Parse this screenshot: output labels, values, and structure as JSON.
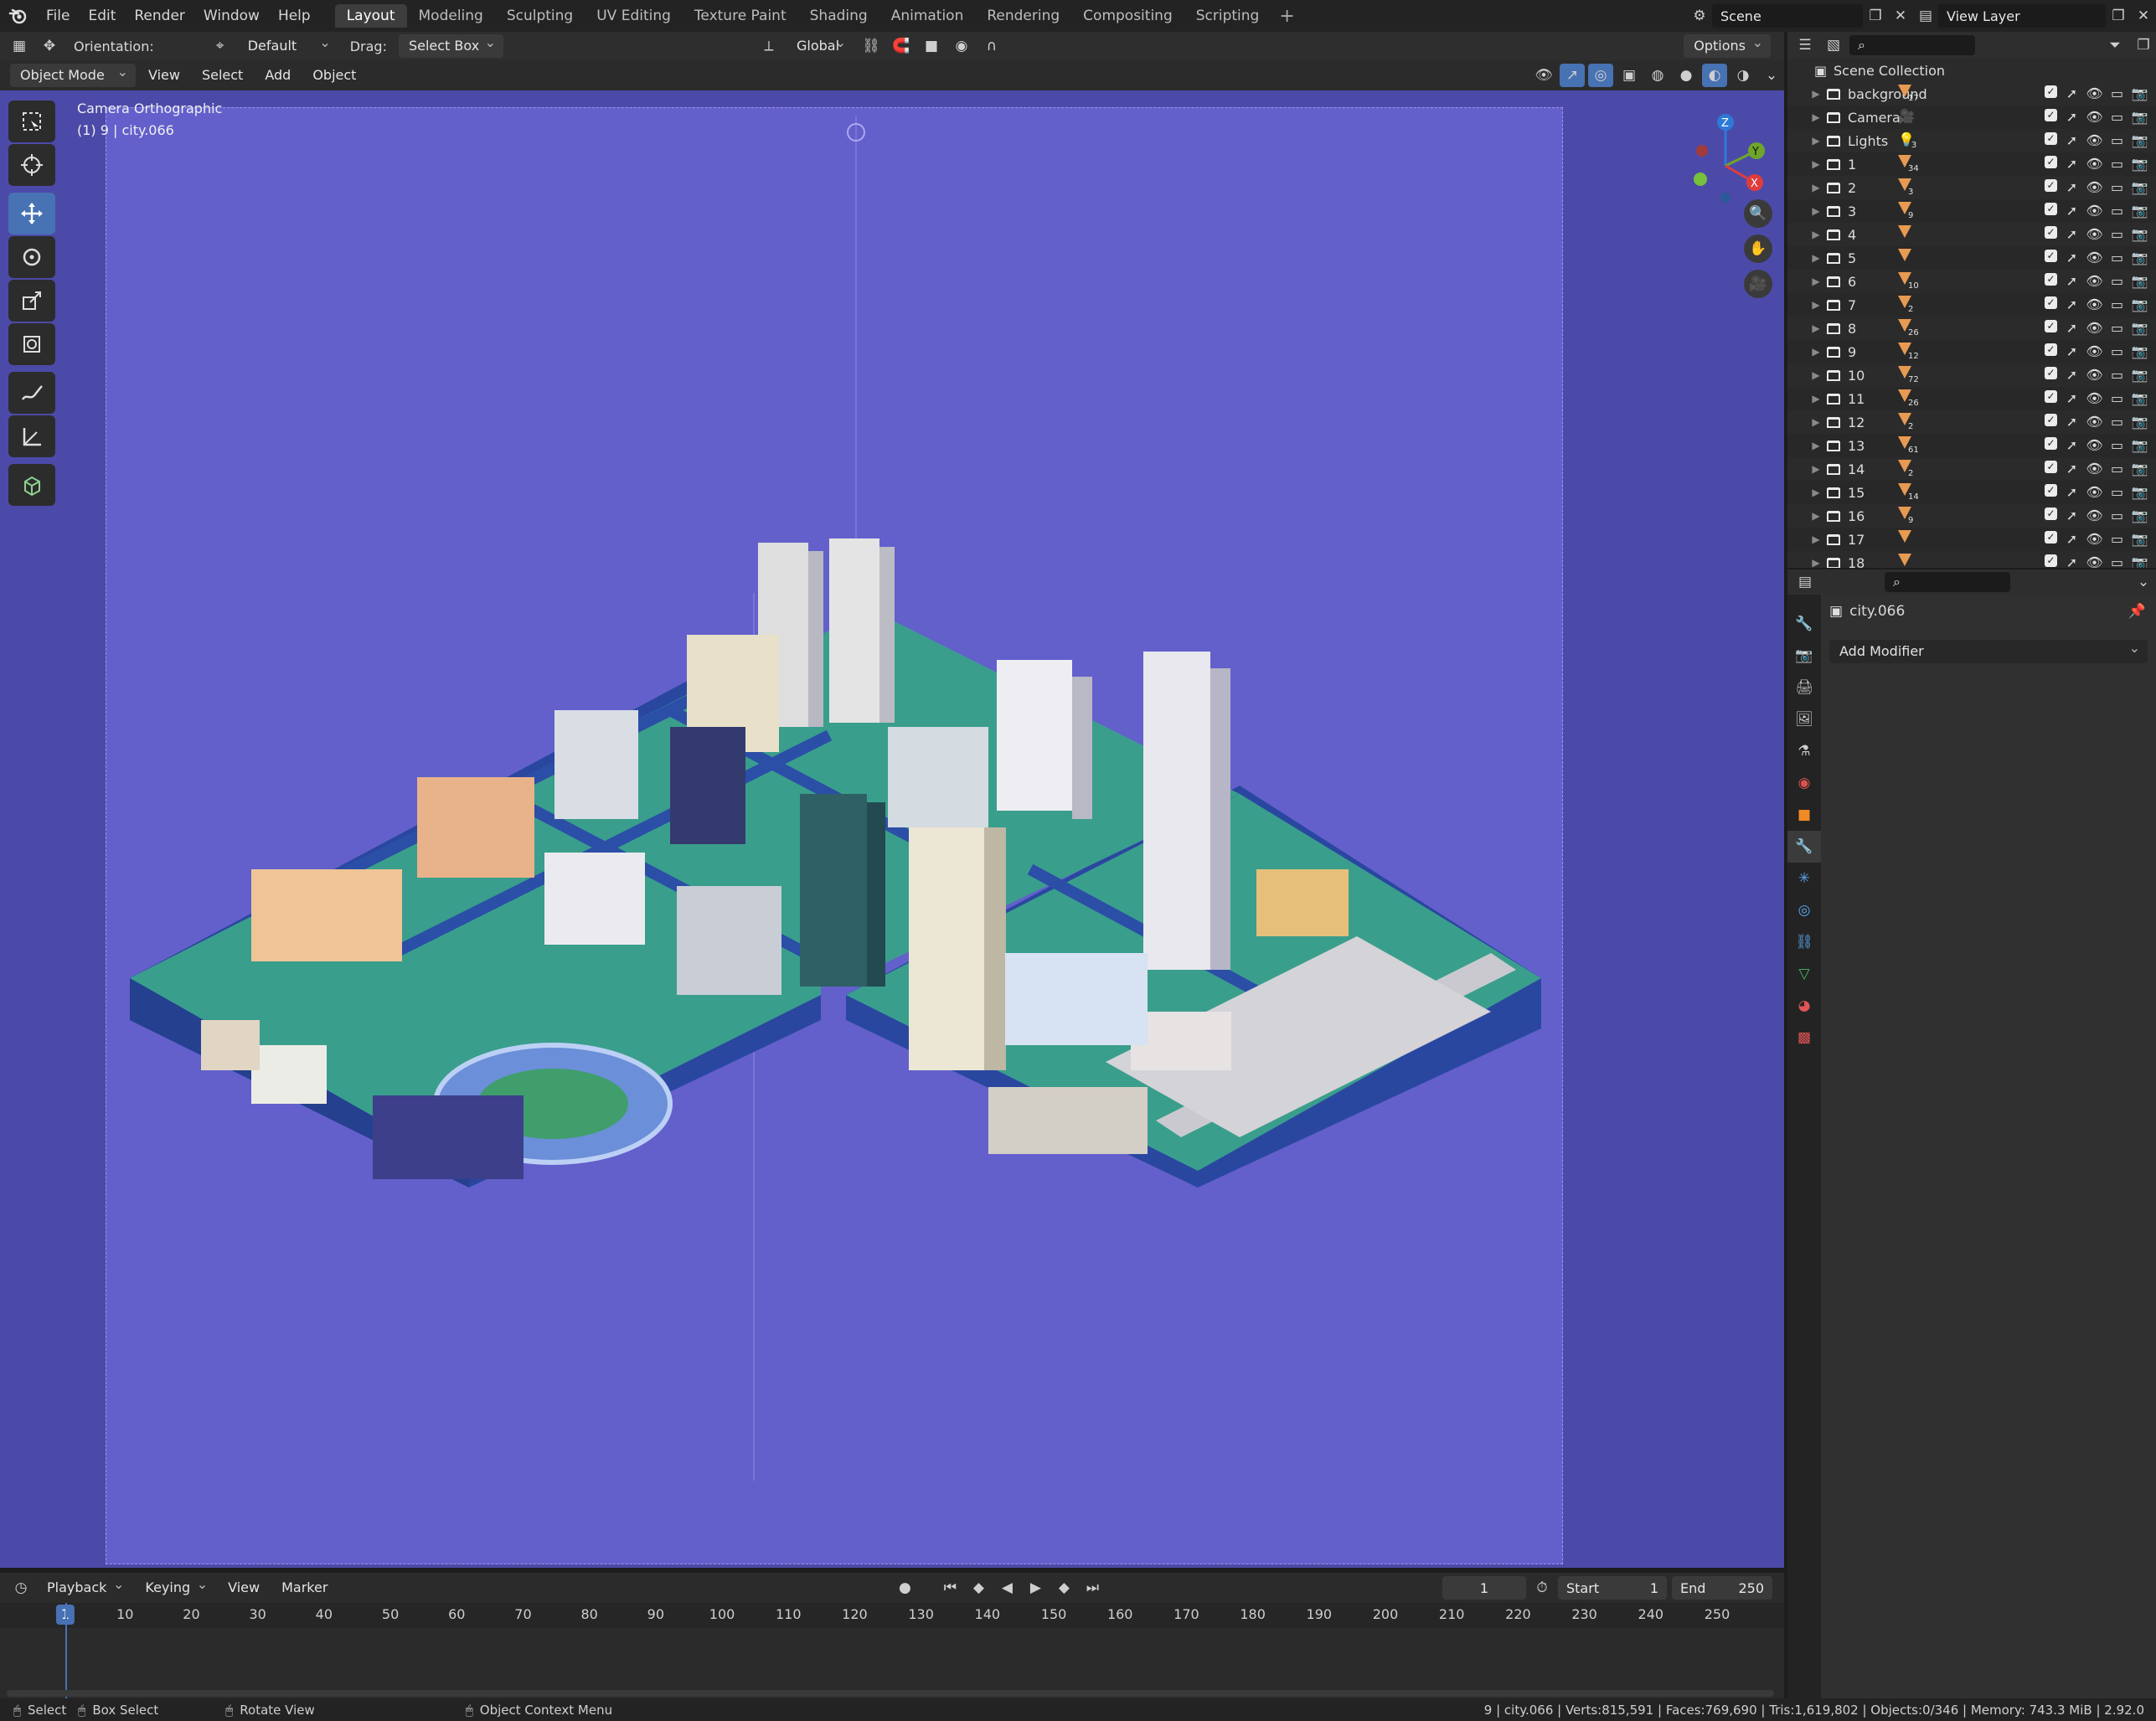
{
  "menubar": {
    "items": [
      "File",
      "Edit",
      "Render",
      "Window",
      "Help"
    ],
    "workspaces": [
      "Layout",
      "Modeling",
      "Sculpting",
      "UV Editing",
      "Texture Paint",
      "Shading",
      "Animation",
      "Rendering",
      "Compositing",
      "Scripting"
    ],
    "active_workspace": "Layout",
    "scene": "Scene",
    "view_layer": "View Layer"
  },
  "tool_header": {
    "orientation_label": "Orientation:",
    "orientation_value": "Default",
    "drag_label": "Drag:",
    "drag_value": "Select Box",
    "transform_orientation": "Global",
    "options_label": "Options"
  },
  "viewport_header": {
    "mode": "Object Mode",
    "menus": [
      "View",
      "Select",
      "Add",
      "Object"
    ]
  },
  "viewport": {
    "camera_label": "Camera Orthographic",
    "object_label": "(1) 9 | city.066"
  },
  "outliner": {
    "root": "Scene Collection",
    "rows": [
      {
        "name": "background",
        "count": "17",
        "kind": "mesh"
      },
      {
        "name": "Camera",
        "count": "",
        "kind": "camera"
      },
      {
        "name": "Lights",
        "count": "3",
        "kind": "light"
      },
      {
        "name": "1",
        "count": "34",
        "kind": "mesh"
      },
      {
        "name": "2",
        "count": "3",
        "kind": "mesh"
      },
      {
        "name": "3",
        "count": "9",
        "kind": "mesh"
      },
      {
        "name": "4",
        "count": "",
        "kind": "mesh"
      },
      {
        "name": "5",
        "count": "",
        "kind": "mesh"
      },
      {
        "name": "6",
        "count": "10",
        "kind": "mesh"
      },
      {
        "name": "7",
        "count": "2",
        "kind": "mesh"
      },
      {
        "name": "8",
        "count": "26",
        "kind": "mesh"
      },
      {
        "name": "9",
        "count": "12",
        "kind": "mesh"
      },
      {
        "name": "10",
        "count": "72",
        "kind": "mesh"
      },
      {
        "name": "11",
        "count": "26",
        "kind": "mesh"
      },
      {
        "name": "12",
        "count": "2",
        "kind": "mesh"
      },
      {
        "name": "13",
        "count": "61",
        "kind": "mesh"
      },
      {
        "name": "14",
        "count": "2",
        "kind": "mesh"
      },
      {
        "name": "15",
        "count": "14",
        "kind": "mesh"
      },
      {
        "name": "16",
        "count": "9",
        "kind": "mesh"
      },
      {
        "name": "17",
        "count": "",
        "kind": "mesh"
      },
      {
        "name": "18",
        "count": "",
        "kind": "mesh"
      }
    ]
  },
  "properties": {
    "object_name": "city.066",
    "add_modifier": "Add Modifier"
  },
  "timeline": {
    "menus": [
      "Playback",
      "Keying",
      "View",
      "Marker"
    ],
    "current_frame": "1",
    "start_label": "Start",
    "start_value": "1",
    "end_label": "End",
    "end_value": "250",
    "ticks": [
      "1",
      "10",
      "20",
      "30",
      "40",
      "50",
      "60",
      "70",
      "80",
      "90",
      "100",
      "110",
      "120",
      "130",
      "140",
      "150",
      "160",
      "170",
      "180",
      "190",
      "200",
      "210",
      "220",
      "230",
      "240",
      "250"
    ]
  },
  "statusbar": {
    "select": "Select",
    "box_select": "Box Select",
    "rotate_view": "Rotate View",
    "context_menu": "Object Context Menu",
    "stats": "9 | city.066 | Verts:815,591 | Faces:769,690 | Tris:1,619,802 | Objects:0/346 | Memory: 743.3 MiB | 2.92.0"
  },
  "colors": {
    "accent": "#4772b3",
    "viewport_bg": "#6360cc",
    "viewport_outer": "#4c4aa8",
    "ground": "#37a38f",
    "base": "#2d4aa0",
    "mesh_icon": "#e79a52"
  }
}
